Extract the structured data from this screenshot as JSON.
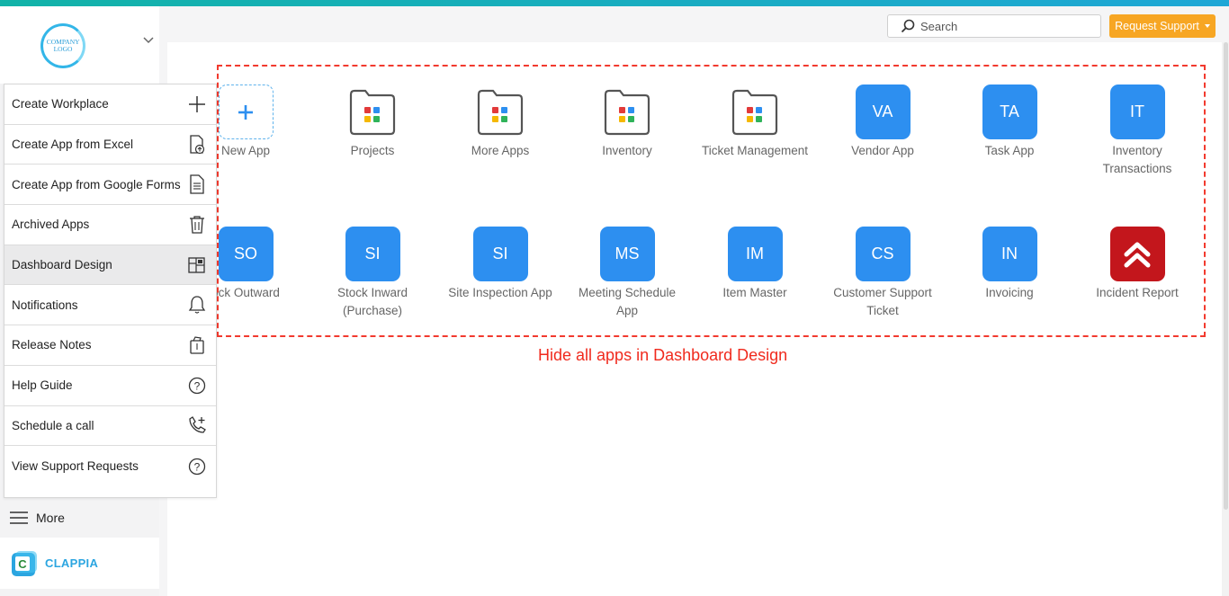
{
  "header": {
    "search_placeholder": "Search",
    "support_label": "Request Support"
  },
  "sidebar": {
    "company_logo_text": "COMPANY LOGO",
    "more_label": "More",
    "brand": "CLAPPIA"
  },
  "menu": {
    "items": [
      {
        "label": "Create Workplace",
        "icon": "plus-icon"
      },
      {
        "label": "Create App from Excel",
        "icon": "file-upload-icon"
      },
      {
        "label": "Create App from Google Forms",
        "icon": "document-icon"
      },
      {
        "label": "Archived Apps",
        "icon": "trash-icon"
      },
      {
        "label": "Dashboard Design",
        "icon": "dashboard-icon",
        "active": true
      },
      {
        "label": "Notifications",
        "icon": "bell-icon"
      },
      {
        "label": "Release Notes",
        "icon": "release-notes-icon"
      },
      {
        "label": "Help Guide",
        "icon": "question-icon"
      },
      {
        "label": "Schedule a call",
        "icon": "phone-plus-icon"
      },
      {
        "label": "View Support Requests",
        "icon": "question-icon"
      }
    ]
  },
  "apps": {
    "row1": [
      {
        "name": "New App",
        "type": "new"
      },
      {
        "name": "Projects",
        "type": "folder"
      },
      {
        "name": "More Apps",
        "type": "folder"
      },
      {
        "name": "Inventory",
        "type": "folder"
      },
      {
        "name": "Ticket Management",
        "type": "folder"
      },
      {
        "name": "Vendor App",
        "type": "badge",
        "initials": "VA"
      },
      {
        "name": "Task App",
        "type": "badge",
        "initials": "TA"
      },
      {
        "name": "Inventory Transactions",
        "type": "badge",
        "initials": "IT"
      }
    ],
    "row2": [
      {
        "name": "ock Outward",
        "type": "badge",
        "initials": "SO"
      },
      {
        "name": "Stock Inward (Purchase)",
        "type": "badge",
        "initials": "SI"
      },
      {
        "name": "Site Inspection App",
        "type": "badge",
        "initials": "SI"
      },
      {
        "name": "Meeting Schedule App",
        "type": "badge",
        "initials": "MS"
      },
      {
        "name": "Item Master",
        "type": "badge",
        "initials": "IM"
      },
      {
        "name": "Customer Support Ticket",
        "type": "badge",
        "initials": "CS"
      },
      {
        "name": "Invoicing",
        "type": "badge",
        "initials": "IN"
      },
      {
        "name": "Incident Report",
        "type": "incident"
      }
    ]
  },
  "annotation": {
    "hint": "Hide all apps in Dashboard Design"
  },
  "colors": {
    "accent_blue": "#2d8ff0",
    "support_orange": "#f7a623",
    "annotation_red": "#f23a2e",
    "incident_red": "#c3161c"
  }
}
